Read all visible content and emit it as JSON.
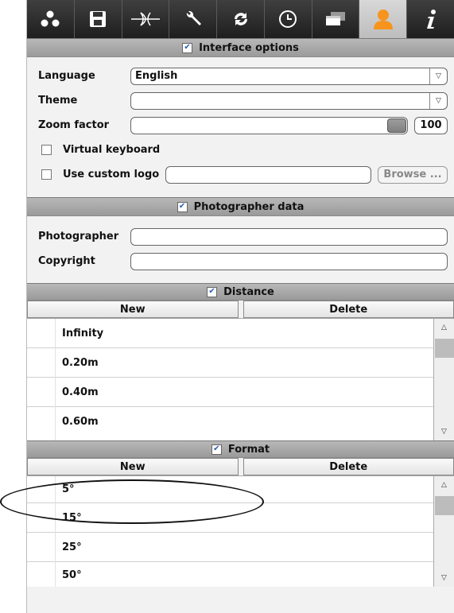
{
  "toolbar": {
    "buttons": [
      {
        "icon": "dots-icon"
      },
      {
        "icon": "save-icon"
      },
      {
        "icon": "lens-icon"
      },
      {
        "icon": "wrench-icon"
      },
      {
        "icon": "sync-icon"
      },
      {
        "icon": "clock-icon"
      },
      {
        "icon": "windows-icon"
      },
      {
        "icon": "user-icon",
        "active": true,
        "color": "#f7941d"
      },
      {
        "icon": "info-icon"
      }
    ]
  },
  "interface_options": {
    "title": "Interface options",
    "checked": true,
    "language_label": "Language",
    "language_value": "English",
    "theme_label": "Theme",
    "theme_value": "",
    "zoom_label": "Zoom factor",
    "zoom_value": "100",
    "virtual_keyboard_label": "Virtual keyboard",
    "custom_logo_label": "Use custom logo",
    "custom_logo_value": "",
    "browse_label": "Browse ..."
  },
  "photographer_data": {
    "title": "Photographer data",
    "checked": true,
    "photographer_label": "Photographer",
    "photographer_value": "",
    "copyright_label": "Copyright",
    "copyright_value": ""
  },
  "distance": {
    "title": "Distance",
    "checked": true,
    "new_label": "New",
    "delete_label": "Delete",
    "items": [
      "Infinity",
      "0.20m",
      "0.40m",
      "0.60m"
    ]
  },
  "format": {
    "title": "Format",
    "checked": true,
    "new_label": "New",
    "delete_label": "Delete",
    "items": [
      "5°",
      "15°",
      "25°",
      "50°"
    ]
  }
}
